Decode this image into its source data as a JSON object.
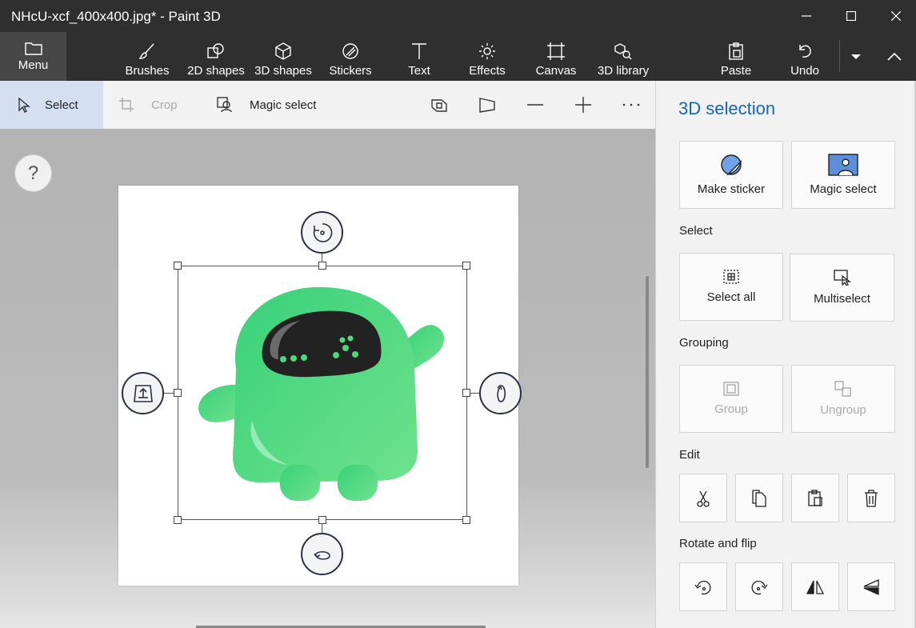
{
  "window": {
    "title": "NHcU-xcf_400x400.jpg* - Paint 3D"
  },
  "ribbon": {
    "menu_label": "Menu",
    "tools": [
      {
        "label": "Brushes",
        "icon": "brush-icon"
      },
      {
        "label": "2D shapes",
        "icon": "2d-shapes-icon"
      },
      {
        "label": "3D shapes",
        "icon": "3d-shapes-icon"
      },
      {
        "label": "Stickers",
        "icon": "stickers-icon"
      },
      {
        "label": "Text",
        "icon": "text-icon"
      },
      {
        "label": "Effects",
        "icon": "effects-icon"
      },
      {
        "label": "Canvas",
        "icon": "canvas-icon"
      },
      {
        "label": "3D library",
        "icon": "3d-library-icon"
      }
    ],
    "paste_label": "Paste",
    "undo_label": "Undo"
  },
  "subbar": {
    "select_label": "Select",
    "crop_label": "Crop",
    "magic_select_label": "Magic select"
  },
  "canvas": {
    "help_label": "?",
    "image_description_icon": "green-robot-sticker-icon"
  },
  "panel": {
    "title": "3D selection",
    "make_sticker_label": "Make sticker",
    "magic_select_label": "Magic select",
    "select_section": "Select",
    "select_all_label": "Select all",
    "multiselect_label": "Multiselect",
    "grouping_section": "Grouping",
    "group_label": "Group",
    "ungroup_label": "Ungroup",
    "edit_section": "Edit",
    "rotate_section": "Rotate and flip"
  },
  "colors": {
    "titlebar": "#2f2f2f",
    "menu_active": "#474747",
    "select_active": "#d5dff2",
    "panel_title": "#1565b7",
    "robot_green": "#4fd879",
    "robot_visor": "#222222"
  }
}
